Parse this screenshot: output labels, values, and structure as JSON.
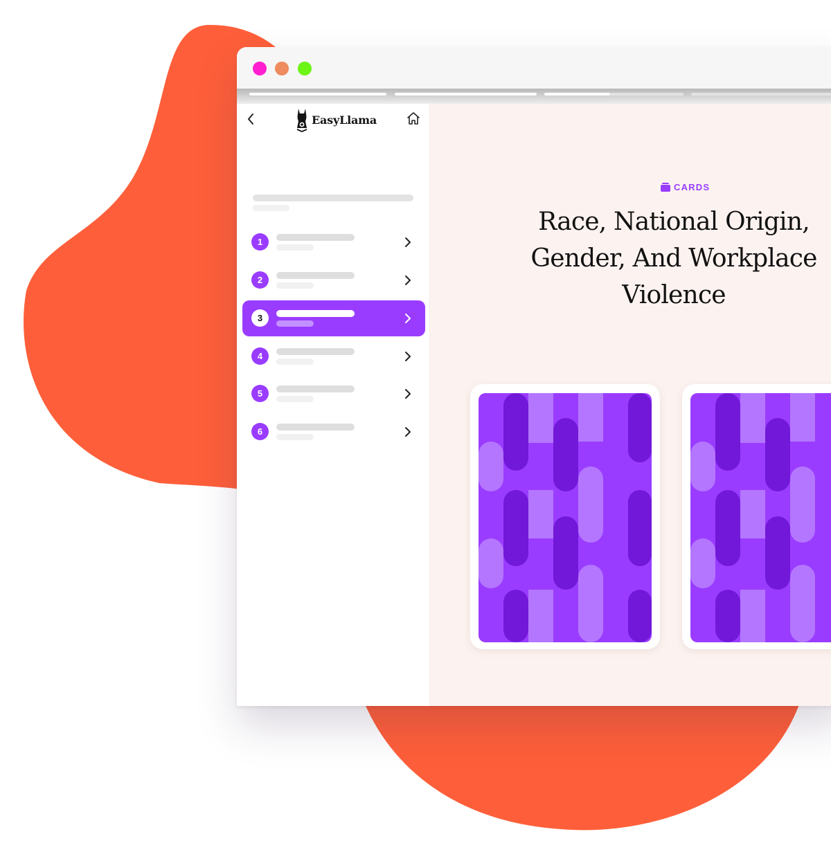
{
  "app": {
    "logo_text": "EasyLlama"
  },
  "window": {
    "traffic_lights": [
      "close",
      "minimize",
      "maximize"
    ]
  },
  "progress": {
    "segments_total": 6,
    "segments_completed": 3
  },
  "sidebar": {
    "lessons": [
      {
        "number": "1",
        "active": false
      },
      {
        "number": "2",
        "active": false
      },
      {
        "number": "3",
        "active": true
      },
      {
        "number": "4",
        "active": false
      },
      {
        "number": "5",
        "active": false
      },
      {
        "number": "6",
        "active": false
      }
    ]
  },
  "main": {
    "section_tag": "CARDS",
    "title": "Race, National Origin, Gender, And Workplace Violence"
  },
  "colors": {
    "accent": "#9a3cff",
    "blob": "#fe5f3a",
    "main_bg": "#fcf3f0",
    "card_dark": "#7218d8",
    "card_light": "#b476ff"
  }
}
